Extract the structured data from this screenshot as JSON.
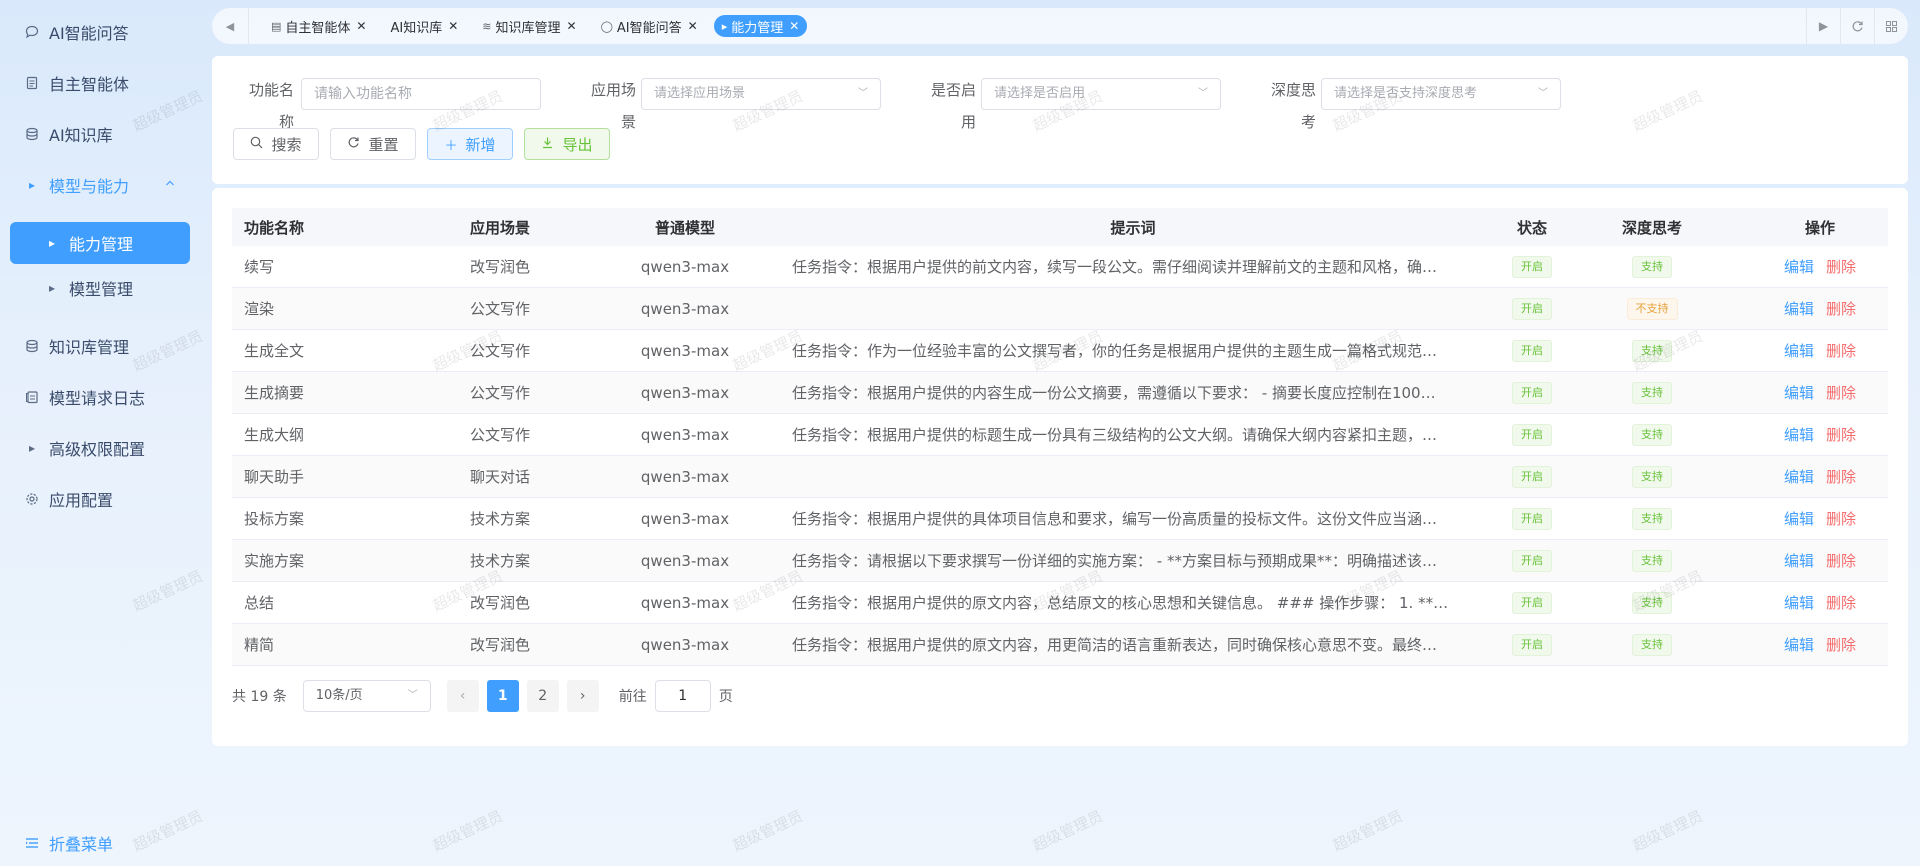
{
  "sidebar": {
    "items": [
      {
        "label": "AI智能问答"
      },
      {
        "label": "自主智能体"
      },
      {
        "label": "AI知识库"
      },
      {
        "label": "模型与能力"
      },
      {
        "label": "能力管理"
      },
      {
        "label": "模型管理"
      },
      {
        "label": "知识库管理"
      },
      {
        "label": "模型请求日志"
      },
      {
        "label": "高级权限配置"
      },
      {
        "label": "应用配置"
      }
    ],
    "collapse_label": "折叠菜单"
  },
  "tabs": [
    {
      "label": "自主智能体"
    },
    {
      "label": "AI知识库"
    },
    {
      "label": "知识库管理"
    },
    {
      "label": "AI智能问答"
    },
    {
      "label": "能力管理"
    }
  ],
  "filters": {
    "name_label": "功能名称",
    "name_placeholder": "请输入功能名称",
    "scene_label": "应用场景",
    "scene_placeholder": "请选择应用场景",
    "enabled_label": "是否启用",
    "enabled_placeholder": "请选择是否启用",
    "deep_label": "深度思考",
    "deep_placeholder": "请选择是否支持深度思考",
    "search": "搜索",
    "reset": "重置",
    "add": "新增",
    "export": "导出"
  },
  "table": {
    "headers": {
      "name": "功能名称",
      "scene": "应用场景",
      "model": "普通模型",
      "prompt": "提示词",
      "status": "状态",
      "deep": "深度思考",
      "op": "操作"
    },
    "edit_label": "编辑",
    "delete_label": "删除",
    "rows": [
      {
        "name": "续写",
        "scene": "改写润色",
        "model": "qwen3-max",
        "prompt": "任务指令：根据用户提供的前文内容，续写一段公文。需仔细阅读并理解前文的主题和风格，确…",
        "status": "开启",
        "deep": "支持"
      },
      {
        "name": "渲染",
        "scene": "公文写作",
        "model": "qwen3-max",
        "prompt": "",
        "status": "开启",
        "deep": "不支持"
      },
      {
        "name": "生成全文",
        "scene": "公文写作",
        "model": "qwen3-max",
        "prompt": "任务指令：作为一位经验丰富的公文撰写者，你的任务是根据用户提供的主题生成一篇格式规范…",
        "status": "开启",
        "deep": "支持"
      },
      {
        "name": "生成摘要",
        "scene": "公文写作",
        "model": "qwen3-max",
        "prompt": "任务指令：根据用户提供的内容生成一份公文摘要，需遵循以下要求： - 摘要长度应控制在100…",
        "status": "开启",
        "deep": "支持"
      },
      {
        "name": "生成大纲",
        "scene": "公文写作",
        "model": "qwen3-max",
        "prompt": "任务指令：根据用户提供的标题生成一份具有三级结构的公文大纲。请确保大纲内容紧扣主题，…",
        "status": "开启",
        "deep": "支持"
      },
      {
        "name": "聊天助手",
        "scene": "聊天对话",
        "model": "qwen3-max",
        "prompt": "",
        "status": "开启",
        "deep": "支持"
      },
      {
        "name": "投标方案",
        "scene": "技术方案",
        "model": "qwen3-max",
        "prompt": "任务指令：根据用户提供的具体项目信息和要求，编写一份高质量的投标文件。这份文件应当涵…",
        "status": "开启",
        "deep": "支持"
      },
      {
        "name": "实施方案",
        "scene": "技术方案",
        "model": "qwen3-max",
        "prompt": "任务指令：请根据以下要求撰写一份详细的实施方案： - **方案目标与预期成果**：明确描述该…",
        "status": "开启",
        "deep": "支持"
      },
      {
        "name": "总结",
        "scene": "改写润色",
        "model": "qwen3-max",
        "prompt": "任务指令：根据用户提供的原文内容，总结原文的核心思想和关键信息。 ### 操作步骤： 1. **…",
        "status": "开启",
        "deep": "支持"
      },
      {
        "name": "精简",
        "scene": "改写润色",
        "model": "qwen3-max",
        "prompt": "任务指令：根据用户提供的原文内容，用更简洁的语言重新表达，同时确保核心意思不变。最终…",
        "status": "开启",
        "deep": "支持"
      }
    ]
  },
  "pagination": {
    "total": "共 19 条",
    "page_size": "10条/页",
    "pages": [
      "1",
      "2"
    ],
    "goto_label": "前往",
    "goto_value": "1",
    "page_suffix": "页"
  },
  "watermark": "超级管理员"
}
